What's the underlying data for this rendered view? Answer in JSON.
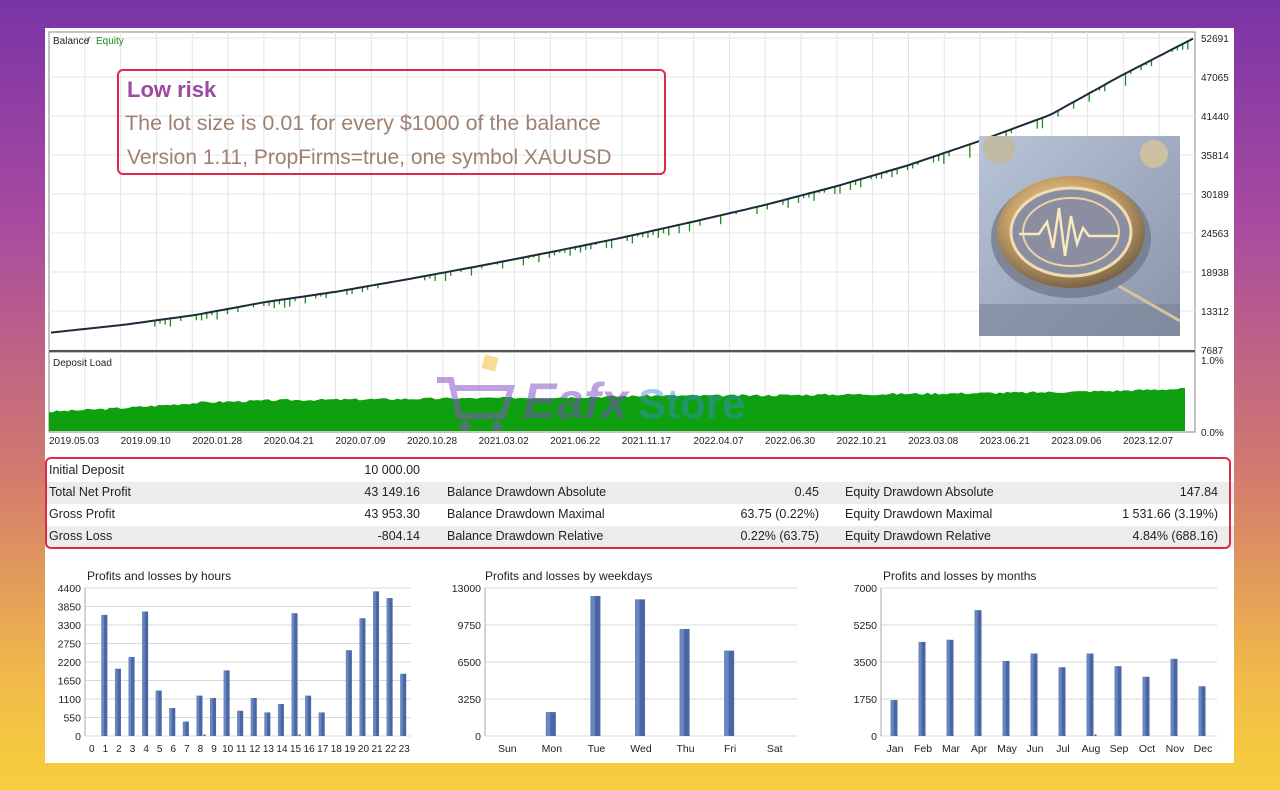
{
  "colors": {
    "accent_red": "#e0284a",
    "balance": "#1c2a3a",
    "equity": "#1f8a1f",
    "load": "#0fa00f",
    "bar": "#4a66a4",
    "neg_bar": "#c03030"
  },
  "balance_chart": {
    "title_balance": "Balance",
    "title_sep": " / ",
    "title_equity": "Equity",
    "y_ticks": [
      "52691",
      "47065",
      "41440",
      "35814",
      "30189",
      "24563",
      "18938",
      "13312",
      "7687"
    ]
  },
  "deposit_load": {
    "title": "Deposit Load",
    "y_ticks": [
      "1.0%",
      "0.0%"
    ],
    "x_ticks": [
      "2019.05.03",
      "2019.09.10",
      "2020.01.28",
      "2020.04.21",
      "2020.07.09",
      "2020.10.28",
      "2021.03.02",
      "2021.06.22",
      "2021.11.17",
      "2022.04.07",
      "2022.06.30",
      "2022.10.21",
      "2023.03.08",
      "2023.06.21",
      "2023.09.06",
      "2023.12.07"
    ]
  },
  "note": {
    "line1": "Low risk",
    "line2": "The lot size is 0.01 for every $1000 of the balance",
    "line3": "Version 1.11, PropFirms=true, one symbol XAUUSD"
  },
  "watermark": {
    "brand_a": "Eafx",
    "brand_b": "Store"
  },
  "stats": {
    "rows": [
      [
        {
          "label": "Initial Deposit",
          "value": "10 000.00"
        },
        {
          "label": "",
          "value": ""
        },
        {
          "label": "",
          "value": ""
        }
      ],
      [
        {
          "label": "Total Net Profit",
          "value": "43 149.16"
        },
        {
          "label": "Balance Drawdown Absolute",
          "value": "0.45"
        },
        {
          "label": "Equity Drawdown Absolute",
          "value": "147.84"
        }
      ],
      [
        {
          "label": "Gross Profit",
          "value": "43 953.30"
        },
        {
          "label": "Balance Drawdown Maximal",
          "value": "63.75 (0.22%)"
        },
        {
          "label": "Equity Drawdown Maximal",
          "value": "1 531.66 (3.19%)"
        }
      ],
      [
        {
          "label": "Gross Loss",
          "value": "-804.14"
        },
        {
          "label": "Balance Drawdown Relative",
          "value": "0.22% (63.75)"
        },
        {
          "label": "Equity Drawdown Relative",
          "value": "4.84% (688.16)"
        }
      ]
    ]
  },
  "chart_data": [
    {
      "type": "line",
      "title": "Balance / Equity",
      "series": [
        {
          "name": "Balance"
        },
        {
          "name": "Equity"
        }
      ],
      "x": [
        "2019.05.03",
        "2019.09.10",
        "2020.01.28",
        "2020.04.21",
        "2020.07.09",
        "2020.10.28",
        "2021.03.02",
        "2021.06.22",
        "2021.11.17",
        "2022.04.07",
        "2022.06.30",
        "2022.10.21",
        "2023.03.08",
        "2023.06.21",
        "2023.09.06",
        "2023.12.07"
      ],
      "y": [
        10200,
        11300,
        12700,
        14600,
        16100,
        17900,
        19800,
        21800,
        23900,
        26200,
        28600,
        31300,
        34300,
        37800,
        41600,
        47300
      ],
      "y_end": 52600,
      "ylim": [
        7687,
        52691
      ]
    },
    {
      "type": "area",
      "title": "Deposit Load",
      "ylim": [
        0,
        1.0
      ],
      "y_unit": "%",
      "levels": [
        0.25,
        0.3,
        0.37,
        0.4,
        0.41,
        0.42,
        0.43,
        0.44,
        0.46,
        0.46,
        0.47,
        0.48,
        0.49,
        0.5,
        0.52,
        0.55
      ]
    },
    {
      "type": "bar",
      "title": "Profits and losses by hours",
      "categories": [
        "0",
        "1",
        "2",
        "3",
        "4",
        "5",
        "6",
        "7",
        "8",
        "9",
        "10",
        "11",
        "12",
        "13",
        "14",
        "15",
        "16",
        "17",
        "18",
        "19",
        "20",
        "21",
        "22",
        "23"
      ],
      "series": [
        {
          "values": [
            0,
            3600,
            2000,
            2350,
            3700,
            1350,
            830,
            430,
            1200,
            1130,
            1950,
            750,
            1130,
            700,
            950,
            3650,
            1200,
            700,
            0,
            2550,
            3500,
            4300,
            4100,
            1850
          ]
        },
        {
          "values": [
            0,
            0,
            0,
            0,
            0,
            0,
            0,
            0,
            30,
            0,
            0,
            0,
            0,
            0,
            0,
            20,
            0,
            0,
            0,
            0,
            0,
            0,
            0,
            0
          ]
        }
      ],
      "y_ticks": [
        "4400",
        "3850",
        "3300",
        "2750",
        "2200",
        "1650",
        "1100",
        "550",
        "0"
      ],
      "ylim": [
        0,
        4400
      ]
    },
    {
      "type": "bar",
      "title": "Profits and losses by weekdays",
      "categories": [
        "Sun",
        "Mon",
        "Tue",
        "Wed",
        "Thu",
        "Fri",
        "Sat"
      ],
      "series": [
        {
          "values": [
            0,
            2100,
            12300,
            12000,
            9400,
            7500,
            0
          ]
        },
        {
          "values": [
            0,
            0,
            0,
            0,
            0,
            0,
            0
          ]
        }
      ],
      "y_ticks": [
        "13000",
        "9750",
        "6500",
        "3250",
        "0"
      ],
      "ylim": [
        0,
        13000
      ]
    },
    {
      "type": "bar",
      "title": "Profits and losses by months",
      "categories": [
        "Jan",
        "Feb",
        "Mar",
        "Apr",
        "May",
        "Jun",
        "Jul",
        "Aug",
        "Sep",
        "Oct",
        "Nov",
        "Dec"
      ],
      "series": [
        {
          "values": [
            1700,
            4450,
            4550,
            5950,
            3550,
            3900,
            3250,
            3900,
            3300,
            2800,
            3650,
            2350
          ]
        },
        {
          "values": [
            0,
            0,
            0,
            0,
            0,
            0,
            0,
            40,
            0,
            0,
            0,
            0
          ]
        }
      ],
      "y_ticks": [
        "7000",
        "5250",
        "3500",
        "1750",
        "0"
      ],
      "ylim": [
        0,
        7000
      ]
    }
  ]
}
